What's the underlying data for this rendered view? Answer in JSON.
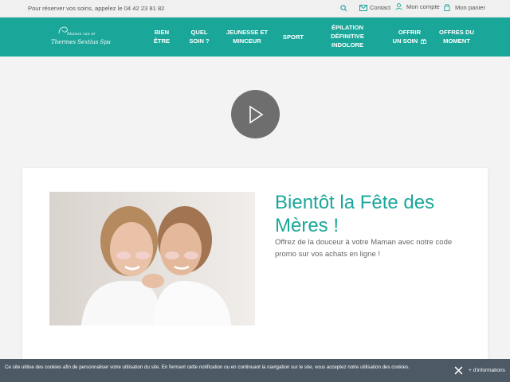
{
  "topbar": {
    "phone_text": "Pour réserver vos soins, appelez le 04 42 23 81 82",
    "contact_label": "Contact",
    "account_label": "Mon compte",
    "cart_label": "Mon panier"
  },
  "logo": {
    "line1": "Maison ran et",
    "line2": "Thermes Sextius Spa"
  },
  "nav": {
    "items": [
      {
        "line1": "BIEN",
        "line2": "ÊTRE"
      },
      {
        "line1": "QUEL",
        "line2": "SOIN ?"
      },
      {
        "line1": "JEUNESSE ET",
        "line2": "MINCEUR"
      },
      {
        "line1": "SPORT",
        "line2": ""
      },
      {
        "line1": "ÉPILATION",
        "line2": "DÉFINITIVE",
        "line3": "INDOLORE"
      },
      {
        "line1": "OFFRIR",
        "line2": "UN SOIN"
      },
      {
        "line1": "OFFRES DU",
        "line2": "MOMENT"
      }
    ]
  },
  "promo": {
    "title": "Bientôt la Fête des Mères !",
    "text": "Offrez de la douceur à votre Maman avec notre code promo sur vos achats en ligne !"
  },
  "cookie": {
    "message": "Ce site utilise des cookies afin de personnaliser votre utilisation du site. En fermant cette notification ou en continuant la navigation sur le site, vous acceptez notre utilisation des cookies.",
    "more_label": "+ d'informations"
  },
  "colors": {
    "brand": "#1aa79a",
    "cookie_bar": "#4d5a66",
    "play_button": "#6e6e6e"
  },
  "icons": [
    "search-icon",
    "mail-icon",
    "user-icon",
    "bag-icon",
    "play-icon",
    "gift-icon",
    "close-icon"
  ]
}
